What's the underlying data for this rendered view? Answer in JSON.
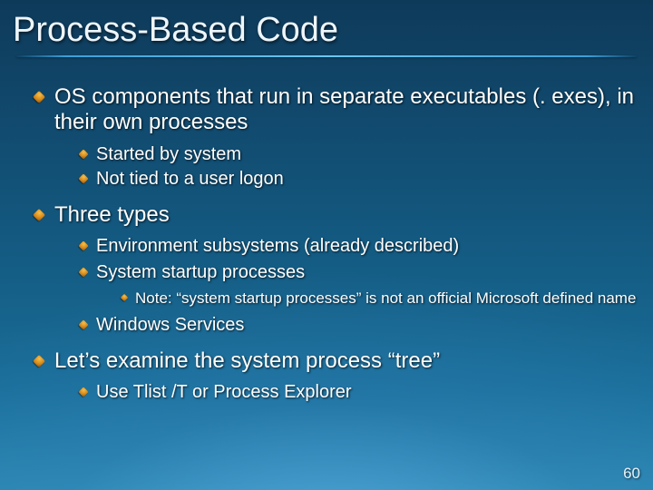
{
  "title": "Process-Based Code",
  "pageNumber": "60",
  "bullets": {
    "b1": "OS components that run in separate executables (. exes), in their own processes",
    "b1a": "Started by system",
    "b1b": "Not tied to a user logon",
    "b2": "Three types",
    "b2a": "Environment subsystems (already described)",
    "b2b": "System startup processes",
    "b2b1": "Note:  “system startup processes” is not an official Microsoft defined name",
    "b2c": "Windows Services",
    "b3": "Let’s examine the system process “tree”",
    "b3a": "Use Tlist /T or Process Explorer"
  }
}
